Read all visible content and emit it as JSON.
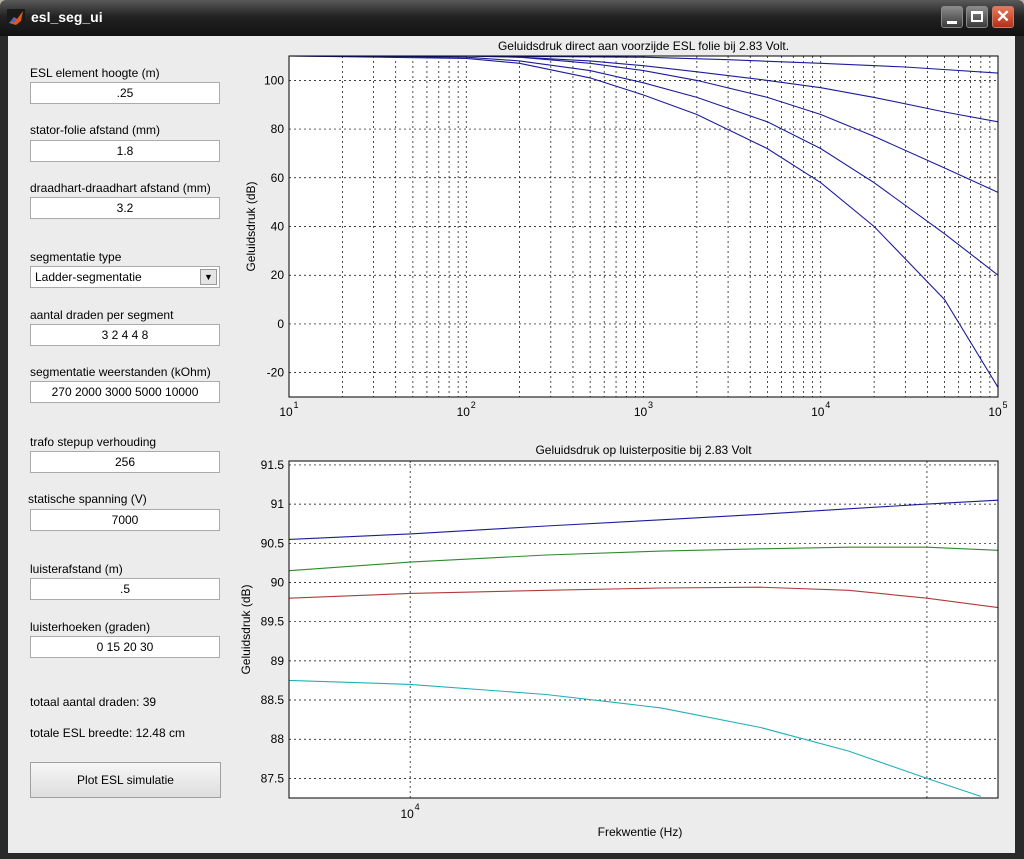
{
  "window": {
    "title": "esl_seg_ui",
    "close_glyph": "✕"
  },
  "form": {
    "esl_height_label": "ESL element hoogte (m)",
    "esl_height_value": ".25",
    "stator_dist_label": "stator-folie afstand (mm)",
    "stator_dist_value": "1.8",
    "wire_dist_label": "draadhart-draadhart afstand (mm)",
    "wire_dist_value": "3.2",
    "seg_type_label": "segmentatie type",
    "seg_type_value": "Ladder-segmentatie",
    "wires_per_seg_label": "aantal draden per segment",
    "wires_per_seg_value": "3 2 4 4 8",
    "seg_res_label": "segmentatie weerstanden (kOhm)",
    "seg_res_value": "270 2000 3000 5000 10000",
    "trafo_label": "trafo stepup verhouding",
    "trafo_value": "256",
    "static_v_label": "statische spanning (V)",
    "static_v_value": "7000",
    "listen_dist_label": "luisterafstand (m)",
    "listen_dist_value": ".5",
    "listen_angles_label": "luisterhoeken (graden)",
    "listen_angles_value": "0 15 20 30",
    "total_wires": "totaal aantal draden: 39",
    "total_width": "totale ESL breedte: 12.48 cm",
    "plot_button": "Plot ESL simulatie"
  },
  "chart_data": [
    {
      "type": "line",
      "title": "Geluidsdruk direct aan voorzijde ESL folie bij 2.83 Volt.",
      "xlabel": "",
      "ylabel": "Geluidsdruk (dB)",
      "xscale": "log",
      "xlim": [
        10,
        100000
      ],
      "ylim": [
        -30,
        110
      ],
      "grid": true,
      "x_tick_labels": [
        "10",
        "1",
        "10",
        "2",
        "10",
        "3",
        "10",
        "4",
        "10",
        "5"
      ],
      "y_ticks": [
        100,
        80,
        60,
        40,
        20,
        0,
        -20
      ],
      "color": "#1c1c9c",
      "series": [
        {
          "x": [
            10,
            100,
            1000,
            3000,
            10000,
            30000,
            100000
          ],
          "values": [
            110,
            110,
            109.5,
            108.5,
            107,
            105.5,
            103
          ]
        },
        {
          "x": [
            10,
            100,
            200,
            500,
            1000,
            2000,
            5000,
            10000,
            20000,
            50000,
            100000
          ],
          "values": [
            110,
            110,
            109.5,
            108,
            106,
            103.5,
            100,
            97,
            93,
            87,
            83
          ]
        },
        {
          "x": [
            10,
            100,
            200,
            500,
            1000,
            2000,
            5000,
            10000,
            20000,
            50000,
            100000
          ],
          "values": [
            110,
            110,
            109.5,
            107,
            104,
            100,
            93,
            86,
            77,
            64,
            54
          ]
        },
        {
          "x": [
            10,
            100,
            200,
            500,
            1000,
            2000,
            5000,
            10000,
            20000,
            50000,
            100000
          ],
          "values": [
            110,
            109.5,
            108,
            104,
            99,
            93,
            83,
            72,
            58,
            37,
            20
          ]
        },
        {
          "x": [
            10,
            100,
            200,
            500,
            1000,
            2000,
            5000,
            10000,
            20000,
            50000,
            100000
          ],
          "values": [
            110,
            109,
            107,
            101,
            94,
            86,
            72,
            58,
            40,
            10,
            -26
          ]
        }
      ]
    },
    {
      "type": "line",
      "title": "Geluidsdruk op luisterpositie bij 2.83 Volt",
      "xlabel": "Frekwentie (Hz)",
      "ylabel": "Geluidsdruk (dB)",
      "xscale": "log",
      "xlim": [
        8500,
        22000
      ],
      "ylim": [
        87.25,
        91.55
      ],
      "grid": true,
      "x_tick_labels": [
        "10",
        "4"
      ],
      "y_ticks": [
        91.5,
        91,
        90.5,
        90,
        89.5,
        89,
        88.5,
        88,
        87.5
      ],
      "series": [
        {
          "color": "#1c1c9c",
          "x": [
            8500,
            10000,
            12000,
            14000,
            16000,
            18000,
            20000,
            22000
          ],
          "values": [
            90.55,
            90.62,
            90.72,
            90.8,
            90.87,
            90.94,
            91.0,
            91.05
          ]
        },
        {
          "color": "#2e8a2e",
          "x": [
            8500,
            10000,
            12000,
            14000,
            16000,
            18000,
            20000,
            22000
          ],
          "values": [
            90.15,
            90.26,
            90.35,
            90.4,
            90.43,
            90.45,
            90.45,
            90.41
          ]
        },
        {
          "color": "#b33a3a",
          "x": [
            8500,
            10000,
            12000,
            14000,
            16000,
            18000,
            20000,
            22000
          ],
          "values": [
            89.8,
            89.86,
            89.9,
            89.93,
            89.94,
            89.9,
            89.8,
            89.68
          ]
        },
        {
          "color": "#20b0b8",
          "x": [
            8500,
            10000,
            12000,
            14000,
            16000,
            18000,
            20000,
            21500
          ],
          "values": [
            88.75,
            88.7,
            88.57,
            88.4,
            88.15,
            87.85,
            87.5,
            87.27
          ]
        }
      ]
    }
  ]
}
